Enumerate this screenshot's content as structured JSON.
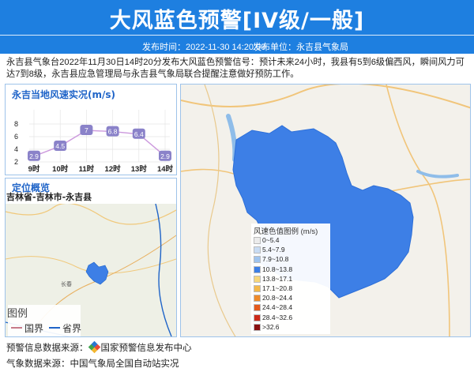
{
  "header": {
    "title": "大风蓝色预警[IV级/一般]",
    "publish_time": "发布时间：2022-11-30 14:20:00",
    "publisher": "发布单位：永吉县气象局"
  },
  "bulletin": {
    "text": "永吉县气象台2022年11月30日14时20分发布大风蓝色预警信号：预计未来24小时，我县有5到6级偏西风，瞬间风力可达7到8级，永吉县应急管理局与永吉县气象局联合提醒注意做好预防工作。"
  },
  "wind_panel": {
    "title": "永吉当地风速实况(m/s)"
  },
  "chart_data": {
    "type": "line",
    "title": "永吉当地风速实况(m/s)",
    "categories": [
      "9时",
      "10时",
      "11时",
      "12时",
      "13时",
      "14时"
    ],
    "values": [
      2.9,
      4.5,
      7,
      6.8,
      6.4,
      2.9
    ],
    "yticks": [
      2,
      4,
      6,
      8
    ],
    "ylim": [
      2,
      9
    ],
    "grid": true,
    "line_color": "#cc99dd",
    "badge_color": "#8a82c9"
  },
  "location_panel": {
    "title": "定位概览",
    "path": "吉林省-吉林市-永吉县",
    "place_label": "长春",
    "legend_title": "图例",
    "legend_items": [
      {
        "label": "国界",
        "color": "#c77a8a"
      },
      {
        "label": "省界",
        "color": "#1f64c8"
      }
    ]
  },
  "wind_legend": {
    "title": "风速色值图例 (m/s)",
    "items": [
      {
        "label": "0~5.4",
        "color": "#ececec"
      },
      {
        "label": "5.4~7.9",
        "color": "#c9dcf3"
      },
      {
        "label": "7.9~10.8",
        "color": "#9fc4ee"
      },
      {
        "label": "10.8~13.8",
        "color": "#3d7fe6"
      },
      {
        "label": "13.8~17.1",
        "color": "#f7d77a"
      },
      {
        "label": "17.1~20.8",
        "color": "#f3b84a"
      },
      {
        "label": "20.8~24.4",
        "color": "#ee8a2a"
      },
      {
        "label": "24.4~28.4",
        "color": "#e45a1e"
      },
      {
        "label": "28.4~32.6",
        "color": "#cc2a1a"
      },
      {
        "label": ">32.6",
        "color": "#8a1010"
      }
    ]
  },
  "footer": {
    "warning_source": "预警信息数据来源：",
    "warning_source_name": "国家预警信息发布中心",
    "weather_source": "气象数据来源：中国气象局全国自动站实况"
  },
  "colors": {
    "header_bg": "#1e7fe0",
    "accent": "#1f64c8",
    "county_fill": "#3d7fe6"
  }
}
